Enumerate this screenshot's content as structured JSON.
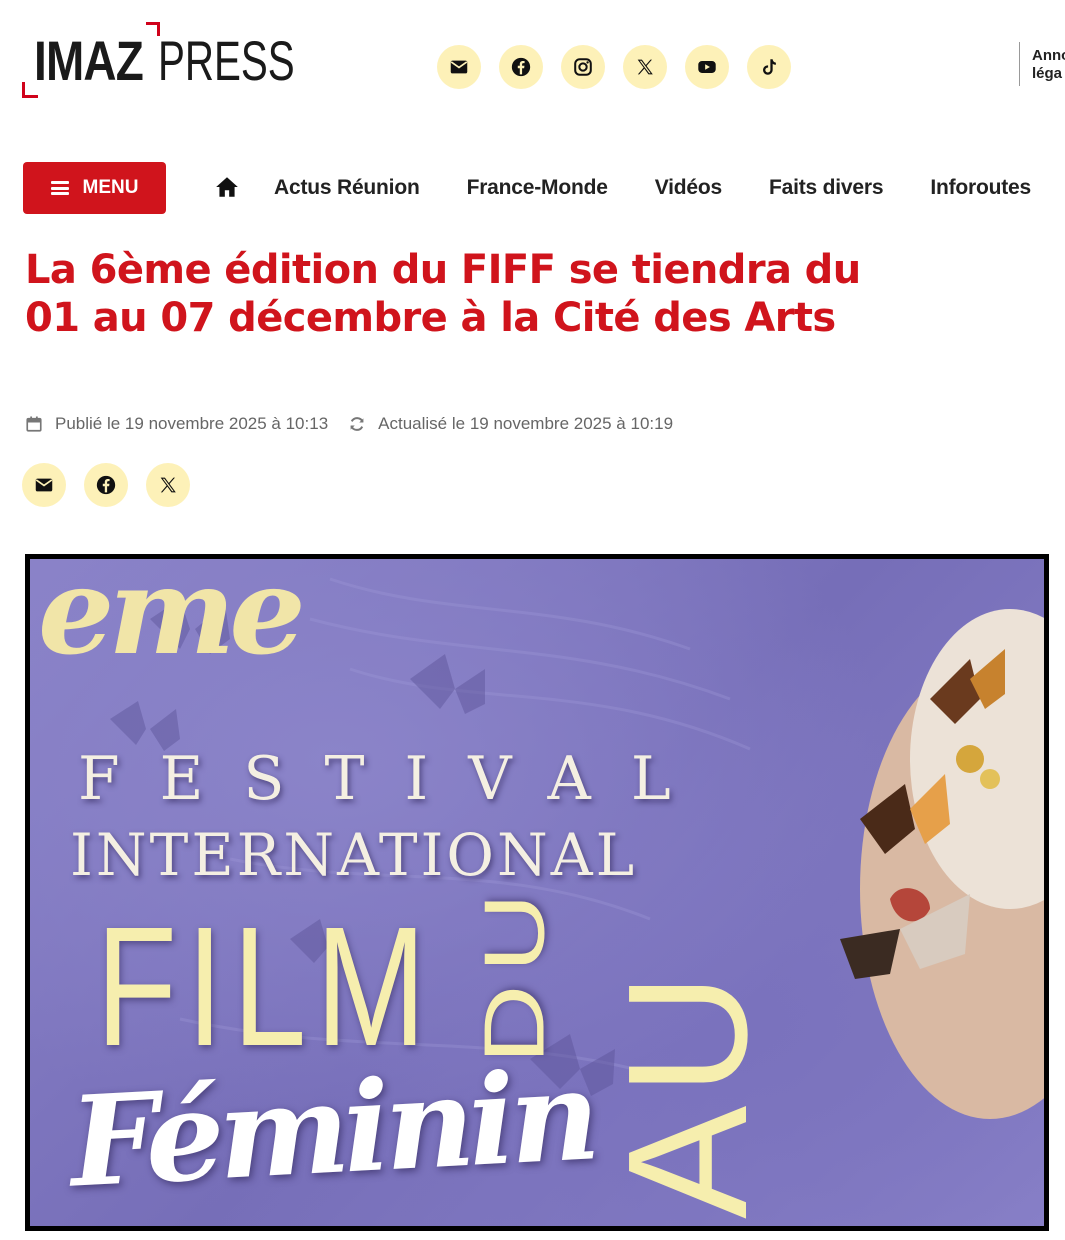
{
  "brand": {
    "logo_part1": "IMAZ",
    "logo_part2": "PRESS",
    "accent": "#d0141c",
    "social_bg": "#fdf1b8"
  },
  "header": {
    "social": [
      {
        "name": "mail-icon"
      },
      {
        "name": "facebook-icon"
      },
      {
        "name": "instagram-icon"
      },
      {
        "name": "x-icon"
      },
      {
        "name": "youtube-icon"
      },
      {
        "name": "tiktok-icon"
      }
    ],
    "side_line1": "Anno",
    "side_line2": "léga"
  },
  "nav": {
    "menu_label": "MENU",
    "items": [
      "Actus Réunion",
      "France-Monde",
      "Vidéos",
      "Faits divers",
      "Inforoutes"
    ]
  },
  "article": {
    "title": "La 6ème édition du FIFF se tiendra du 01 au 07 décembre à la Cité des Arts",
    "published": "Publié le 19 novembre 2025 à 10:13",
    "updated": "Actualisé le 19 novembre 2025 à 10:19",
    "share": [
      {
        "name": "mail-icon"
      },
      {
        "name": "facebook-icon"
      },
      {
        "name": "x-icon"
      }
    ]
  },
  "hero": {
    "eme": "eme",
    "festival": "FESTIVAL",
    "international": "INTERNATIONAL",
    "film": "FILM",
    "du": "DU",
    "feminin": "Féminin",
    "au": "AU"
  }
}
